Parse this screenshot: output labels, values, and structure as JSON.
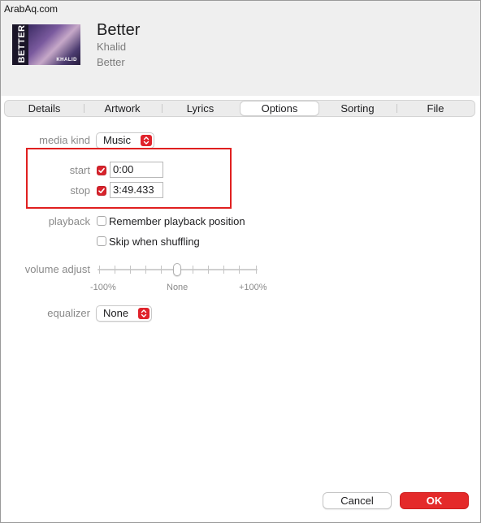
{
  "watermark": "ArabAq.com",
  "song": {
    "title": "Better",
    "artist": "Khalid",
    "album": "Better",
    "artwork_text": "BETTER",
    "artwork_artist_text": "KHALID"
  },
  "tabs": [
    {
      "label": "Details",
      "active": false
    },
    {
      "label": "Artwork",
      "active": false
    },
    {
      "label": "Lyrics",
      "active": false
    },
    {
      "label": "Options",
      "active": true
    },
    {
      "label": "Sorting",
      "active": false
    },
    {
      "label": "File",
      "active": false
    }
  ],
  "options": {
    "media_kind_label": "media kind",
    "media_kind_value": "Music",
    "start_label": "start",
    "start_checked": true,
    "start_value": "0:00",
    "stop_label": "stop",
    "stop_checked": true,
    "stop_value": "3:49.433",
    "playback_label": "playback",
    "remember_position_label": "Remember playback position",
    "remember_position_checked": false,
    "skip_shuffling_label": "Skip when shuffling",
    "skip_shuffling_checked": false,
    "volume_label": "volume adjust",
    "volume_min_label": "-100%",
    "volume_mid_label": "None",
    "volume_max_label": "+100%",
    "volume_value_percent": 0,
    "equalizer_label": "equalizer",
    "equalizer_value": "None"
  },
  "buttons": {
    "cancel_label": "Cancel",
    "ok_label": "OK"
  },
  "colors": {
    "accent": "#e0222b",
    "highlight_box": "#e02020"
  },
  "icons": {
    "popup_arrows": "chevron-up-down-icon",
    "checkmark": "checkmark-icon"
  }
}
